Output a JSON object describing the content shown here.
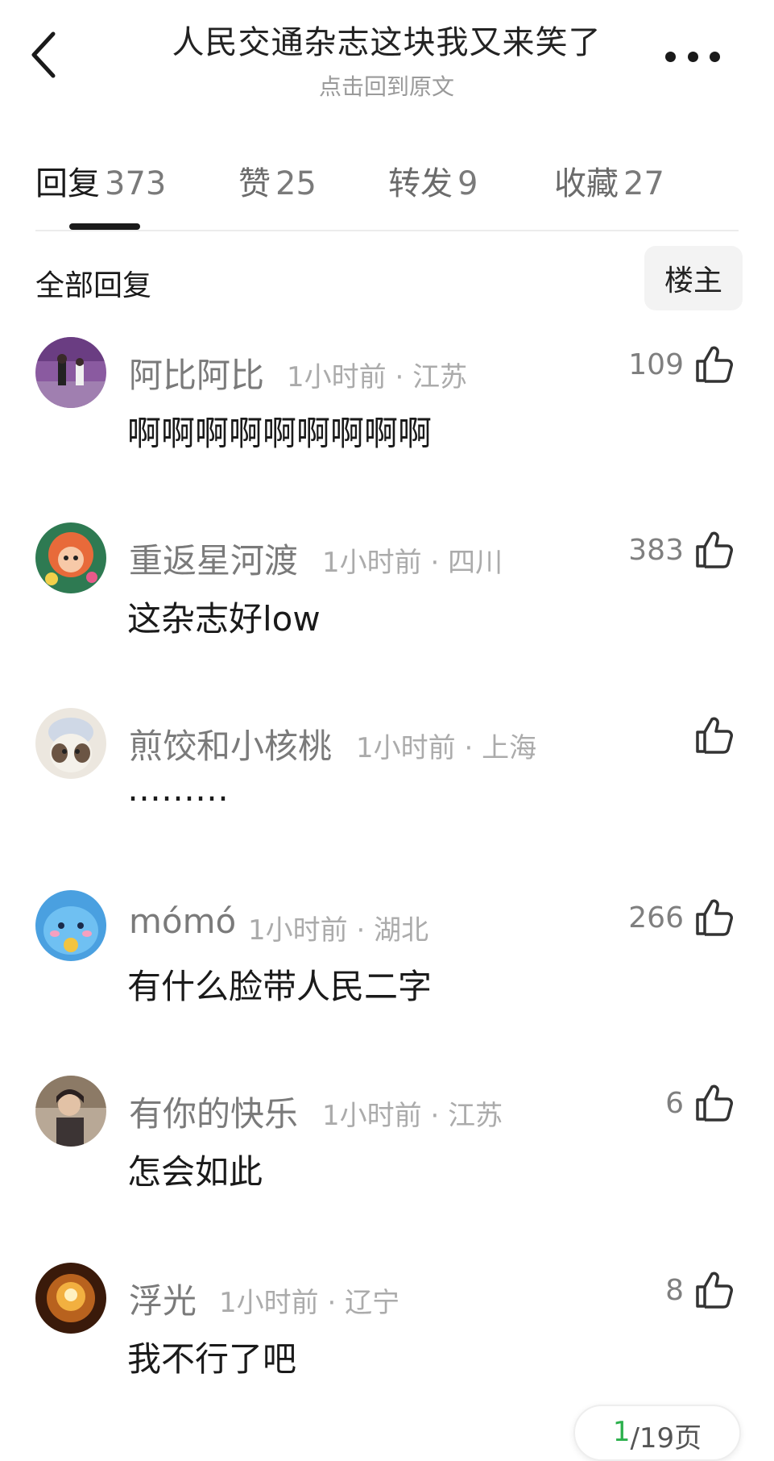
{
  "header": {
    "title": "人民交通杂志这块我又来笑了",
    "subtitle": "点击回到原文"
  },
  "tabs": [
    {
      "label": "回复",
      "count": "373"
    },
    {
      "label": "赞",
      "count": "25"
    },
    {
      "label": "转发",
      "count": "9"
    },
    {
      "label": "收藏",
      "count": "27"
    }
  ],
  "section": {
    "all_replies": "全部回复",
    "op_button": "楼主"
  },
  "comments": [
    {
      "name": "阿比阿比",
      "time": "1小时前",
      "location": "江苏",
      "likes": "109",
      "text": "啊啊啊啊啊啊啊啊啊",
      "avatar": "avatar-purple-photo"
    },
    {
      "name": "重返星河渡",
      "time": "1小时前",
      "location": "四川",
      "likes": "383",
      "text": "这杂志好low",
      "avatar": "avatar-illustrated-girl"
    },
    {
      "name": "煎饺和小核桃",
      "time": "1小时前",
      "location": "上海",
      "likes": "",
      "text": "………",
      "avatar": "avatar-cat"
    },
    {
      "name": "mómó",
      "time": "1小时前",
      "location": "湖北",
      "likes": "266",
      "text": "有什么脸带人民二字",
      "avatar": "avatar-blue-cartoon"
    },
    {
      "name": "有你的快乐",
      "time": "1小时前",
      "location": "江苏",
      "likes": "6",
      "text": "怎会如此",
      "avatar": "avatar-person-photo"
    },
    {
      "name": "浮光",
      "time": "1小时前",
      "location": "辽宁",
      "likes": "8",
      "text": "我不行了吧",
      "avatar": "avatar-golden-light"
    }
  ],
  "pagination": {
    "current": "1",
    "total_label": "/19页"
  },
  "colors": {
    "accent_green": "#2bb04c",
    "text_primary": "#1a1a1a",
    "text_secondary": "#9a9a9a"
  }
}
